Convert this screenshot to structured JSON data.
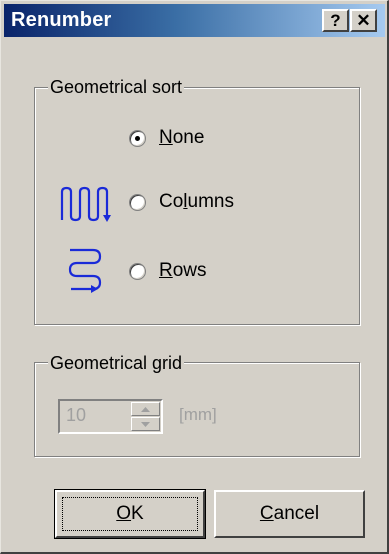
{
  "window": {
    "title": "Renumber"
  },
  "titlebar_buttons": {
    "help": "?",
    "close": "✕"
  },
  "sort_group": {
    "legend": "Geometrical sort",
    "options": [
      {
        "label_mn": "N",
        "label_rest": "one",
        "selected": true,
        "icon": "none"
      },
      {
        "label_pre": "Co",
        "label_mn": "l",
        "label_rest": "umns",
        "selected": false,
        "icon": "columns-serpentine-icon"
      },
      {
        "label_mn": "R",
        "label_rest": "ows",
        "selected": false,
        "icon": "rows-serpentine-icon"
      }
    ]
  },
  "grid_group": {
    "legend": "Geometrical grid",
    "value": "10",
    "unit": "[mm]",
    "enabled": false
  },
  "buttons": {
    "ok": {
      "mn": "O",
      "rest": "K"
    },
    "cancel": {
      "mn": "C",
      "rest": "ancel"
    }
  },
  "colors": {
    "title_start": "#0a246a",
    "title_end": "#a6caf0",
    "face": "#d4d0c8",
    "icon_blue": "#1a2ad8",
    "disabled_text": "#a0a0a0"
  }
}
